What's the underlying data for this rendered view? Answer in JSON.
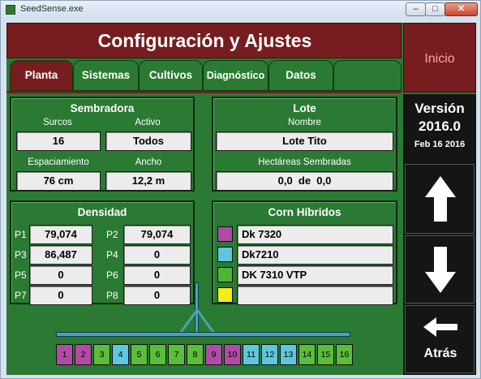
{
  "window": {
    "title": "SeedSense.exe",
    "minimize": "–",
    "maximize": "□",
    "close": "✕"
  },
  "header": {
    "title": "Configuración y Ajustes",
    "home_label": "Inicio"
  },
  "tabs": [
    {
      "label": "Planta",
      "active": true
    },
    {
      "label": "Sistemas"
    },
    {
      "label": "Cultivos"
    },
    {
      "label": "Diagnóstico"
    },
    {
      "label": "Datos"
    },
    {
      "label": ""
    }
  ],
  "sembradora": {
    "title": "Sembradora",
    "surcos_label": "Surcos",
    "surcos_value": "16",
    "activo_label": "Activo",
    "activo_value": "Todos",
    "espaciamiento_label": "Espaciamiento",
    "espaciamiento_value": "76 cm",
    "ancho_label": "Ancho",
    "ancho_value": "12,2 m"
  },
  "lote": {
    "title": "Lote",
    "nombre_label": "Nombre",
    "nombre_value": "Lote Tito",
    "hectareas_label": "Hectáreas Sembradas",
    "hectareas_value": "0,0  de  0,0"
  },
  "densidad": {
    "title": "Densidad",
    "items": [
      {
        "label": "P1",
        "value": "79,074"
      },
      {
        "label": "P2",
        "value": "79,074"
      },
      {
        "label": "P3",
        "value": "86,487"
      },
      {
        "label": "P4",
        "value": "0"
      },
      {
        "label": "P5",
        "value": "0"
      },
      {
        "label": "P6",
        "value": "0"
      },
      {
        "label": "P7",
        "value": "0"
      },
      {
        "label": "P8",
        "value": "0"
      }
    ]
  },
  "hibridos": {
    "title": "Corn Híbridos",
    "items": [
      {
        "color": "#b24aa8",
        "value": "Dk 7320"
      },
      {
        "color": "#5ec6dd",
        "value": "Dk7210"
      },
      {
        "color": "#4fb531",
        "value": "DK 7310 VTP"
      },
      {
        "color": "#f3ee14",
        "value": ""
      }
    ]
  },
  "version": {
    "title": "Versión",
    "number": "2016.0",
    "date": "Feb 16 2016"
  },
  "nav": {
    "up_icon": "arrow-up-icon",
    "down_icon": "arrow-down-icon",
    "back_icon": "arrow-left-icon",
    "back_label": "Atrás"
  },
  "rows": [
    {
      "label": "1",
      "color": "#b24aa8"
    },
    {
      "label": "2",
      "color": "#b24aa8"
    },
    {
      "label": "3",
      "color": "#5bbd39"
    },
    {
      "label": "4",
      "color": "#5ec6dd"
    },
    {
      "label": "5",
      "color": "#5bbd39"
    },
    {
      "label": "6",
      "color": "#5bbd39"
    },
    {
      "label": "7",
      "color": "#5bbd39"
    },
    {
      "label": "8",
      "color": "#5bbd39"
    },
    {
      "label": "9",
      "color": "#b24aa8"
    },
    {
      "label": "10",
      "color": "#b24aa8"
    },
    {
      "label": "11",
      "color": "#5ec6dd"
    },
    {
      "label": "12",
      "color": "#5ec6dd"
    },
    {
      "label": "13",
      "color": "#5ec6dd"
    },
    {
      "label": "14",
      "color": "#5bbd39"
    },
    {
      "label": "15",
      "color": "#5bbd39"
    },
    {
      "label": "16",
      "color": "#5bbd39"
    }
  ],
  "colors": {
    "accent_red": "#771d1f",
    "panel_green": "#2a7a33",
    "side_dark": "#151515"
  }
}
